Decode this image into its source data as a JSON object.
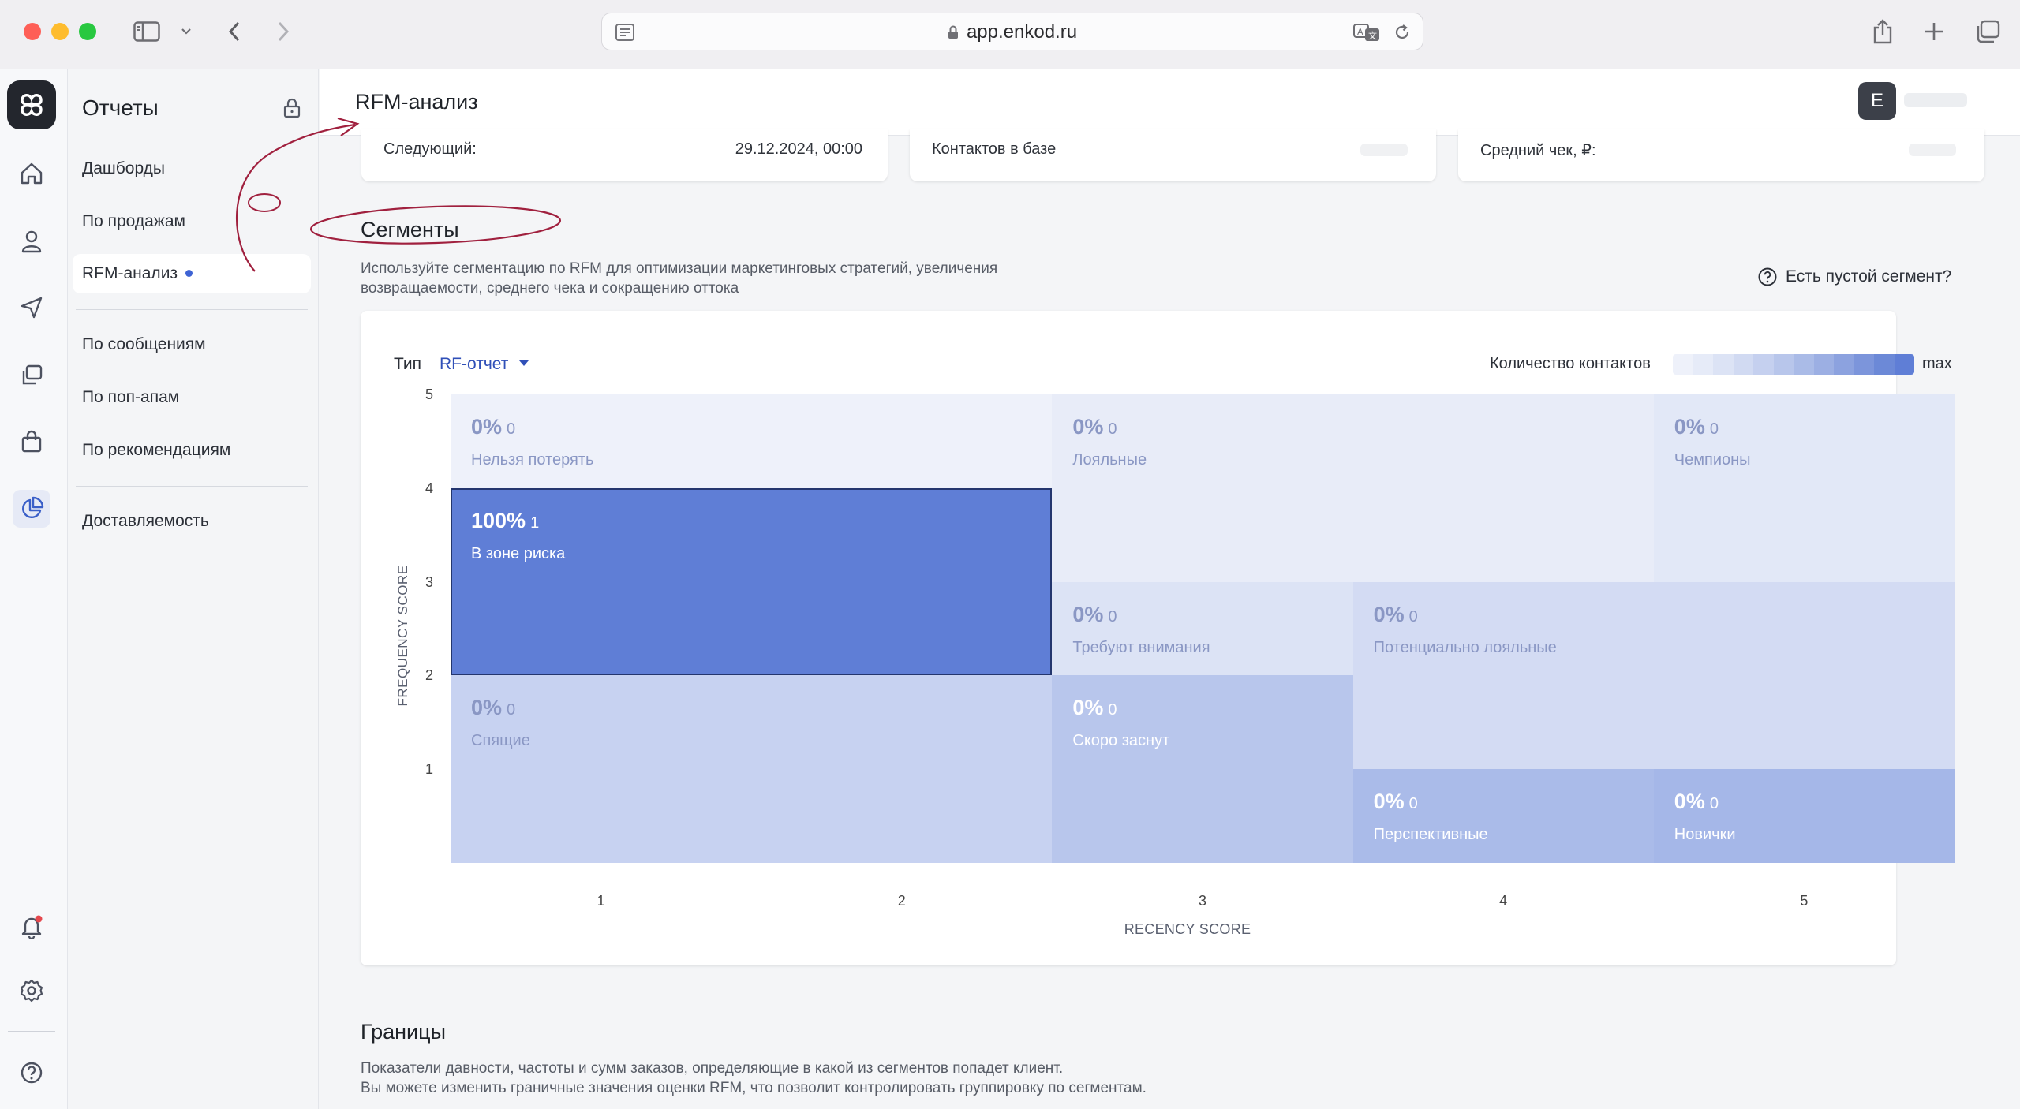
{
  "browser": {
    "url": "app.enkod.ru"
  },
  "sidebar": {
    "title": "Отчеты",
    "items": [
      {
        "label": "Дашборды"
      },
      {
        "label": "По продажам"
      },
      {
        "label": "RFM-анализ",
        "active": true
      },
      {
        "label": "По сообщениям"
      },
      {
        "label": "По поп-апам"
      },
      {
        "label": "По рекомендациям"
      },
      {
        "label": "Доставляемость"
      }
    ]
  },
  "header": {
    "title": "RFM-анализ",
    "avatar_letter": "E"
  },
  "stats": {
    "next_label": "Следующий:",
    "next_value": "29.12.2024, 00:00",
    "contacts_label": "Контактов в базе",
    "avg_check_label": "Средний чек, ₽:"
  },
  "segments": {
    "title": "Сегменты",
    "description_line1": "Используйте сегментацию по RFM для оптимизации маркетинговых стратегий, увеличения",
    "description_line2": "возвращаемости, среднего чека и сокращению оттока",
    "help_link": "Есть пустой сегмент?",
    "type_label": "Тип",
    "type_value": "RF-отчет",
    "legend_label": "Количество контактов",
    "legend_max": "max",
    "legend_colors": [
      "#eef1fa",
      "#e6ebf8",
      "#dce3f5",
      "#d1daf2",
      "#c5d0ef",
      "#b8c6eb",
      "#aabbe7",
      "#9cafe3",
      "#8ca2df",
      "#7c95db",
      "#6c89d7",
      "#5f7ed6"
    ]
  },
  "chart_data": {
    "type": "heatmap",
    "xlabel": "RECENCY SCORE",
    "ylabel": "FREQUENCY SCORE",
    "x_ticks": [
      "1",
      "2",
      "3",
      "4",
      "5"
    ],
    "y_ticks": [
      "5",
      "4",
      "3",
      "2",
      "1"
    ],
    "cells": [
      {
        "name": "Нельзя потерять",
        "percent": "0%",
        "count": "0",
        "recency": [
          1,
          2
        ],
        "frequency": [
          5,
          5
        ],
        "color": "#eef1fa",
        "text_color": "#8a97c4"
      },
      {
        "name": "Лояльные",
        "percent": "0%",
        "count": "0",
        "recency": [
          3,
          4
        ],
        "frequency": [
          4,
          5
        ],
        "color": "#e8ecf8",
        "text_color": "#8a97c4"
      },
      {
        "name": "Чемпионы",
        "percent": "0%",
        "count": "0",
        "recency": [
          5,
          5
        ],
        "frequency": [
          4,
          5
        ],
        "color": "#e2e8f7",
        "text_color": "#8a97c4"
      },
      {
        "name": "В зоне риска",
        "percent": "100%",
        "count": "1",
        "recency": [
          1,
          2
        ],
        "frequency": [
          3,
          4
        ],
        "color": "#5f7ed6",
        "text_color": "#ffffff",
        "highlighted": true
      },
      {
        "name": "Требуют внимания",
        "percent": "0%",
        "count": "0",
        "recency": [
          3,
          3
        ],
        "frequency": [
          3,
          3
        ],
        "color": "#dce3f5",
        "text_color": "#8a97c4"
      },
      {
        "name": "Потенциально лояльные",
        "percent": "0%",
        "count": "0",
        "recency": [
          4,
          5
        ],
        "frequency": [
          2,
          3
        ],
        "color": "#d3dbf3",
        "text_color": "#8a97c4"
      },
      {
        "name": "Спящие",
        "percent": "0%",
        "count": "0",
        "recency": [
          1,
          2
        ],
        "frequency": [
          1,
          2
        ],
        "color": "#c7d2f1",
        "text_color": "#8a97c4"
      },
      {
        "name": "Скоро заснут",
        "percent": "0%",
        "count": "0",
        "recency": [
          3,
          3
        ],
        "frequency": [
          1,
          2
        ],
        "color": "#b8c6ec",
        "text_color": "#ffffff"
      },
      {
        "name": "Перспективные",
        "percent": "0%",
        "count": "0",
        "recency": [
          4,
          4
        ],
        "frequency": [
          1,
          1
        ],
        "color": "#aabbe9",
        "text_color": "#ffffff"
      },
      {
        "name": "Новички",
        "percent": "0%",
        "count": "0",
        "recency": [
          5,
          5
        ],
        "frequency": [
          1,
          1
        ],
        "color": "#a5b7e8",
        "text_color": "#ffffff"
      }
    ]
  },
  "borders": {
    "title": "Границы",
    "description_line1": "Показатели давности, частоты и сумм заказов, определяющие в какой из сегментов попадет клиент.",
    "description_line2": "Вы можете изменить граничные значения оценки RFM, что позволит контролировать группировку по сегментам."
  },
  "annotation_color": "#a0203e"
}
